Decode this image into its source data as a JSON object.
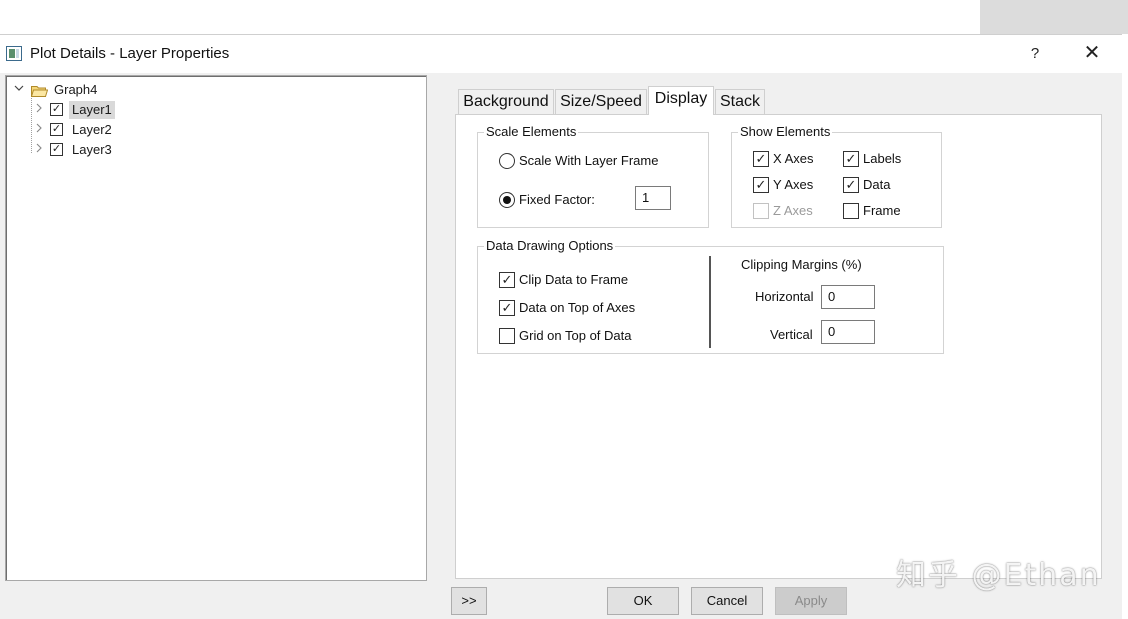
{
  "window": {
    "title": "Plot Details - Layer Properties",
    "help_glyph": "?",
    "close_glyph": "✕"
  },
  "tree": {
    "root": {
      "label": "Graph4",
      "expander": "v"
    },
    "layers": [
      {
        "label": "Layer1",
        "checked": true,
        "selected": true
      },
      {
        "label": "Layer2",
        "checked": true,
        "selected": false
      },
      {
        "label": "Layer3",
        "checked": true,
        "selected": false
      }
    ],
    "check_glyph": "✓",
    "collapsed_glyph": ">"
  },
  "tabs": [
    {
      "label": "Background",
      "active": false
    },
    {
      "label": "Size/Speed",
      "active": false
    },
    {
      "label": "Display",
      "active": true
    },
    {
      "label": "Stack",
      "active": false
    }
  ],
  "scale_elements": {
    "title": "Scale Elements",
    "options": [
      {
        "label": "Scale With Layer Frame",
        "selected": false
      },
      {
        "label": "Fixed Factor:",
        "selected": true
      }
    ],
    "fixed_factor_value": "1"
  },
  "show_elements": {
    "title": "Show Elements",
    "items": [
      {
        "label": "X Axes",
        "checked": true,
        "enabled": true
      },
      {
        "label": "Labels",
        "checked": true,
        "enabled": true
      },
      {
        "label": "Y Axes",
        "checked": true,
        "enabled": true
      },
      {
        "label": "Data",
        "checked": true,
        "enabled": true
      },
      {
        "label": "Z Axes",
        "checked": false,
        "enabled": false
      },
      {
        "label": "Frame",
        "checked": false,
        "enabled": true
      }
    ]
  },
  "data_drawing": {
    "title": "Data Drawing Options",
    "options": [
      {
        "label": "Clip Data to Frame",
        "checked": true
      },
      {
        "label": "Data on Top of Axes",
        "checked": true
      },
      {
        "label": "Grid on Top of Data",
        "checked": false
      }
    ],
    "clipping": {
      "title": "Clipping Margins (%)",
      "horizontal_label": "Horizontal",
      "horizontal_value": "0",
      "vertical_label": "Vertical",
      "vertical_value": "0"
    }
  },
  "buttons": {
    "expand": ">>",
    "ok": "OK",
    "cancel": "Cancel",
    "apply": "Apply"
  },
  "watermark": "知乎 @Ethan"
}
